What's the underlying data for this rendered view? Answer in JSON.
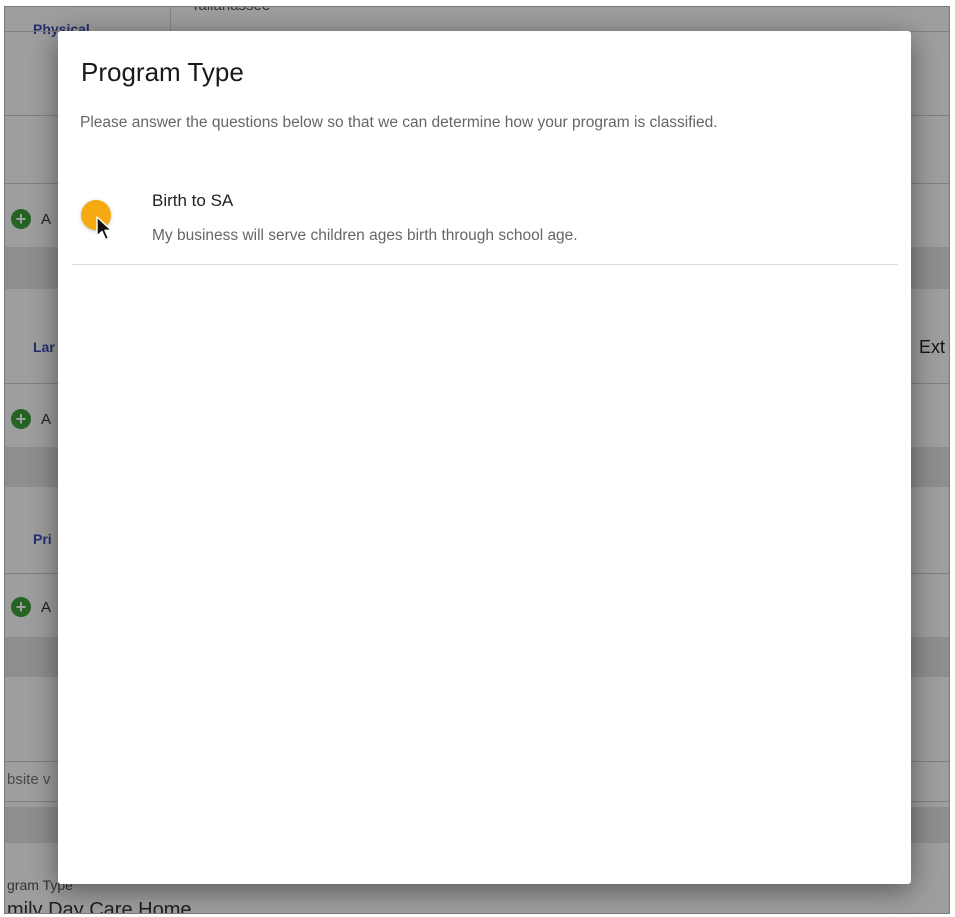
{
  "background": {
    "city_partial": "Tallahassee",
    "section_physical": "Physical",
    "section_language_partial": "Lar",
    "section_primary_partial": "Pri",
    "add_partial": "A",
    "ext_partial": "Ext",
    "website_partial": "bsite v",
    "program_type_label_partial": "gram Type",
    "program_type_value_partial": "mily Day Care Home"
  },
  "modal": {
    "title": "Program Type",
    "description": "Please answer the questions below so that we can determine how your program is classified.",
    "options": [
      {
        "title": "Birth to SA",
        "description": "My business will serve children ages birth through school age.",
        "radio_color": "#f4aa10"
      }
    ]
  },
  "colors": {
    "overlay": "rgba(0,0,0,0.38)",
    "add_icon": "#3aa13a",
    "section_label": "#3a4db5"
  }
}
